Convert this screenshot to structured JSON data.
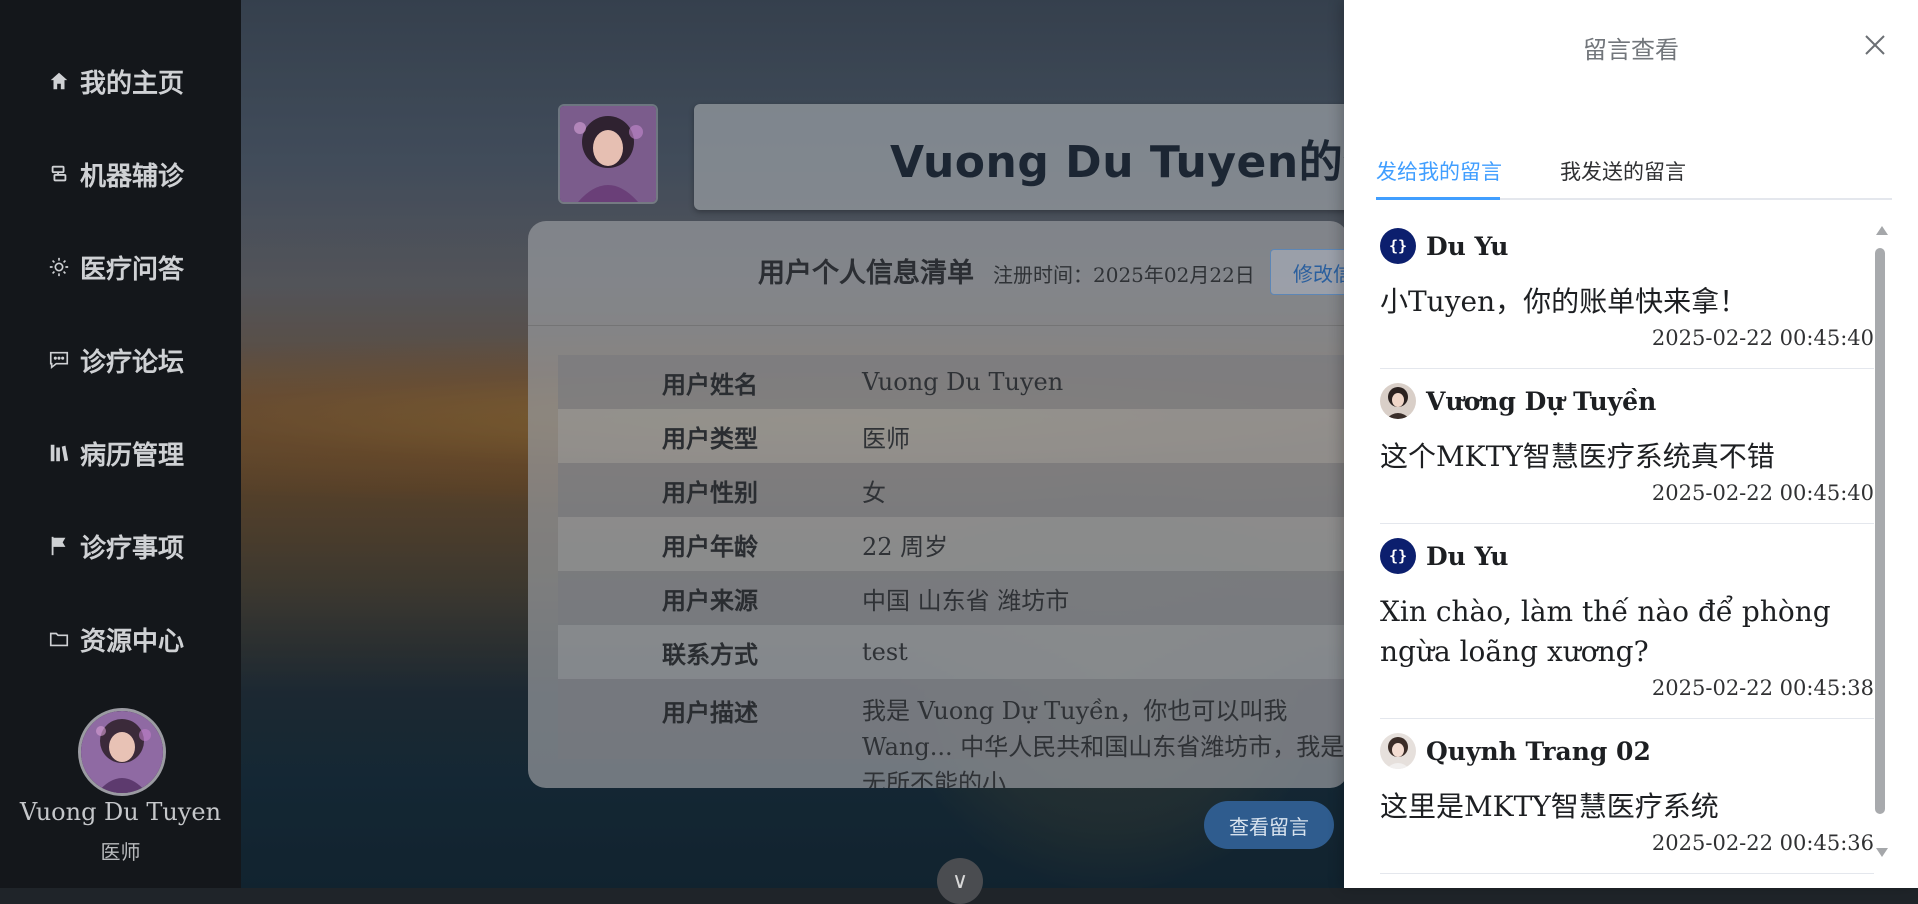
{
  "sidebar": {
    "items": [
      {
        "label": "我的主页",
        "icon": "home-icon"
      },
      {
        "label": "机器辅诊",
        "icon": "robot-icon"
      },
      {
        "label": "医疗问答",
        "icon": "sun-icon"
      },
      {
        "label": "诊疗论坛",
        "icon": "chat-icon"
      },
      {
        "label": "病历管理",
        "icon": "records-icon"
      },
      {
        "label": "诊疗事项",
        "icon": "flag-icon"
      },
      {
        "label": "资源中心",
        "icon": "folder-icon"
      }
    ],
    "user_name": "Vuong Du Tuyen",
    "user_role": "医师"
  },
  "profile": {
    "title": "Vuong Du Tuyen的个人主页",
    "info_title": "用户个人信息清单",
    "reg_time": "注册时间：2025年02月22日",
    "edit_label": "修改信息",
    "rows": [
      {
        "key": "用户姓名",
        "value": "Vuong Du Tuyen"
      },
      {
        "key": "用户类型",
        "value": "医师"
      },
      {
        "key": "用户性别",
        "value": "女"
      },
      {
        "key": "用户年龄",
        "value": "22 周岁"
      },
      {
        "key": "用户来源",
        "value": "中国 山东省 潍坊市"
      },
      {
        "key": "联系方式",
        "value": "test"
      },
      {
        "key": "用户描述",
        "value": "我是 Vuong Dự Tuyền，你也可以叫我 Wang... 中华人民共和国山东省潍坊市，我是无所不能的小..."
      }
    ],
    "view_messages_label": "查看留言",
    "down_label": "∨"
  },
  "drawer": {
    "title": "留言查看",
    "tabs": [
      {
        "label": "发给我的留言",
        "active": true
      },
      {
        "label": "我发送的留言",
        "active": false
      }
    ],
    "messages": [
      {
        "name": "Du Yu",
        "avatar": "code-avatar",
        "text": "小Tuyen，你的账单快来拿！",
        "time": "2025-02-22 00:45:40"
      },
      {
        "name": "Vương Dự Tuyền",
        "avatar": "photo-avatar",
        "text": "这个MKTY智慧医疗系统真不错",
        "time": "2025-02-22 00:45:40"
      },
      {
        "name": "Du Yu",
        "avatar": "code-avatar",
        "text": "Xin chào, làm thế nào để phòng ngừa loãng xương?",
        "time": "2025-02-22 00:45:38"
      },
      {
        "name": "Quynh Trang 02",
        "avatar": "photo-avatar",
        "text": "这里是MKTY智慧医疗系统",
        "time": "2025-02-22 00:45:36"
      }
    ]
  },
  "colors": {
    "accent": "#409eff",
    "sidebar_bg": "#14171b",
    "code_avatar_bg": "#0c1f6e"
  }
}
